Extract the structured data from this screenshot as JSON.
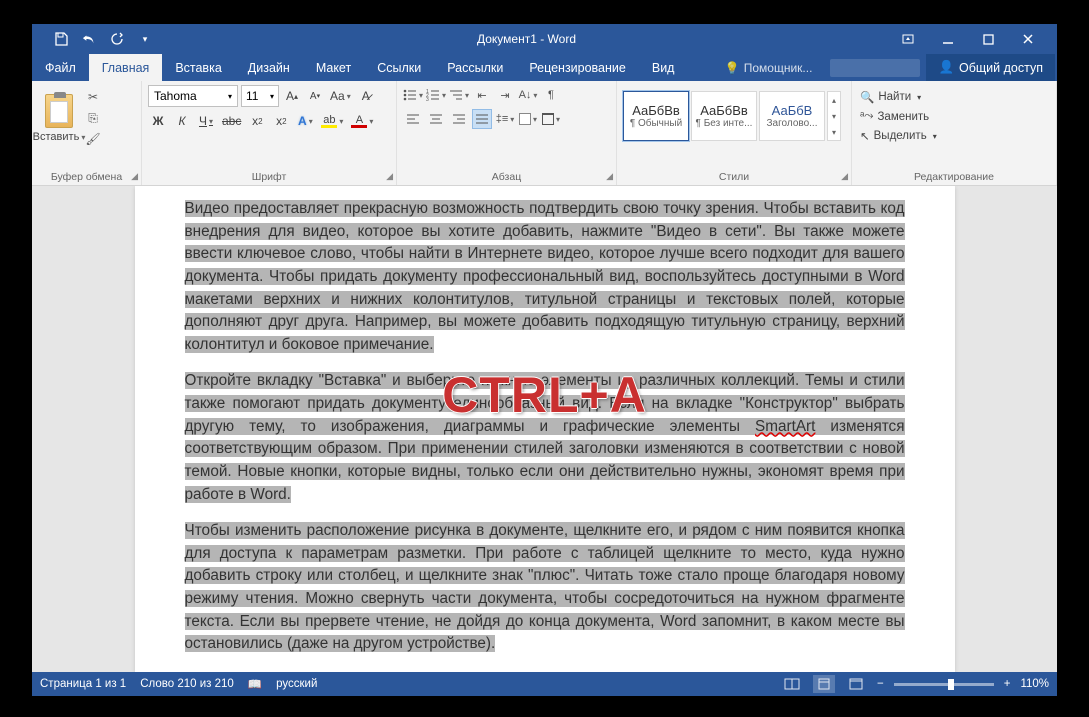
{
  "title": "Документ1 - Word",
  "tabs": {
    "file": "Файл",
    "home": "Главная",
    "insert": "Вставка",
    "design": "Дизайн",
    "layout": "Макет",
    "references": "Ссылки",
    "mailings": "Рассылки",
    "review": "Рецензирование",
    "view": "Вид",
    "tell_me": "Помощник...",
    "share": "Общий доступ"
  },
  "ribbon": {
    "clipboard": {
      "paste": "Вставить",
      "group": "Буфер обмена"
    },
    "font": {
      "name": "Tahoma",
      "size": "11",
      "bold": "Ж",
      "italic": "К",
      "underline": "Ч",
      "strike": "abc",
      "sub": "x₂",
      "sup": "x²",
      "text_effects": "A",
      "highlight": "",
      "color": "A",
      "grow": "A",
      "shrink": "A",
      "case": "Aa",
      "clear": "",
      "group": "Шрифт"
    },
    "paragraph": {
      "group": "Абзац"
    },
    "styles": {
      "group": "Стили",
      "items": [
        {
          "sample": "АаБбВв",
          "name": "¶ Обычный"
        },
        {
          "sample": "АаБбВв",
          "name": "¶ Без инте..."
        },
        {
          "sample": "АаБбВ",
          "name": "Заголово..."
        }
      ]
    },
    "editing": {
      "group": "Редактирование",
      "find": "Найти",
      "replace": "Заменить",
      "select": "Выделить"
    }
  },
  "document": {
    "p1": "Видео предоставляет прекрасную возможность подтвердить свою точку зрения. Чтобы вставить код внедрения для видео, которое вы хотите добавить, нажмите \"Видео в сети\". Вы также можете ввести ключевое слово, чтобы найти в Интернете видео, которое лучше всего подходит для вашего документа. Чтобы придать документу профессиональный вид, воспользуйтесь доступными в Word макетами верхних и нижних колонтитулов, титульной страницы и текстовых полей, которые дополняют друг друга. Например, вы можете добавить подходящую титульную страницу, верхний колонтитул и боковое примечание.",
    "p2a": "Откройте вкладку \"Вставка\" и выберите нужные элементы из различных коллекций. Темы и стили также помогают придать документу единообразный вид. Если на вкладке \"Конструктор\" выбрать другую тему, то изображения, диаграммы и графические элементы ",
    "p2b": "SmartArt",
    "p2c": " изменятся соответствующим образом. При применении стилей заголовки изменяются в соответствии с новой темой. Новые кнопки, которые видны, только если они действительно нужны, экономят время при работе в Word.",
    "p3": "Чтобы изменить расположение рисунка в документе, щелкните его, и рядом с ним появится кнопка для доступа к параметрам разметки. При работе с таблицей щелкните то место, куда нужно добавить строку или столбец, и щелкните знак \"плюс\". Читать тоже стало проще благодаря новому режиму чтения. Можно свернуть части документа, чтобы сосредоточиться на нужном фрагменте текста. Если вы прервете чтение, не дойдя до конца документа, Word запомнит, в каком месте вы остановились (даже на другом устройстве)."
  },
  "overlay": "CTRL+A",
  "status": {
    "page": "Страница 1 из 1",
    "words": "Слово 210 из 210",
    "lang": "русский",
    "zoom": "110%"
  }
}
